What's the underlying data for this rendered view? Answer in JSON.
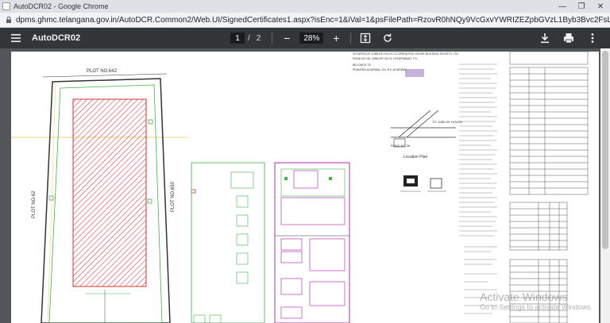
{
  "window": {
    "title": "AutoDCR02 - Google Chrome"
  },
  "address_bar": {
    "url": "dpms.ghmc.telangana.gov.in/AutoDCR.Common2/Web.UI/SignedCertificates1.aspx?isEnc=1&iVal=1&psFilePath=RzovR0hNQy9VcGxvYWRIZEZpbGVzL1Byb3Bvc2FsL0dlTUMvMjAxOC9TRVAvQUR..."
  },
  "pdf_toolbar": {
    "title": "AutoDCR02",
    "page": "1",
    "total_pages": "2",
    "zoom": "28%"
  },
  "drawing": {
    "plot_top_label": "PLOT NO.642",
    "plot_left_label": "PLOT NO.62",
    "plot_right_label": "PLOT NO.650",
    "location_label": "Location Plan",
    "road_label": "TO JUBILEE HOUSE",
    "road_label_2": "ROAD NO.36",
    "header_lines": [
      "SITUATED AT JUBILEE HILLS CO-OPERATIVE HOUSE BUILDING SOCIETY LTD.",
      "ROAD NO.36, JUBILEE HILLS, HYDERABAD, T.S.",
      "BELONGS TO",
      "PRAVEEN AGARWAL S/o. R.K.AGARWAL"
    ]
  },
  "watermark": {
    "line1": "Activate Windows",
    "line2": "Go to Settings to activate Windows."
  },
  "colors": {
    "toolbar": "#323639",
    "viewer_bg": "#525659",
    "hatch": "#e04040",
    "green_line": "#3fb24a",
    "magenta_line": "#c050c0"
  }
}
